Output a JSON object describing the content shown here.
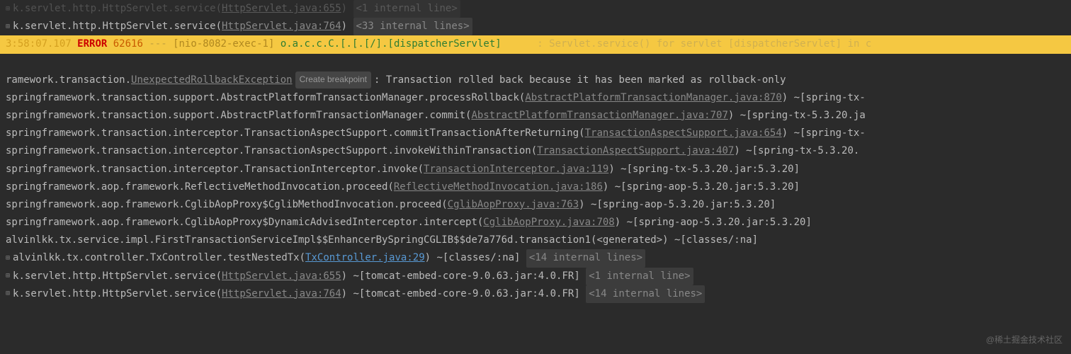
{
  "topline0": {
    "prefix": "k.servlet.http.HttpServlet.service(",
    "link": "HttpServlet.java:655",
    "suffix": ")",
    "internal": "<1 internal line>"
  },
  "topline1": {
    "prefix": "k.servlet.http.HttpServlet.service(",
    "link": "HttpServlet.java:764",
    "suffix": ")",
    "internal": "<33 internal lines>"
  },
  "log": {
    "ts": "3:58:07.107",
    "level": "ERROR",
    "pid": "62616",
    "sep": "---",
    "thread": "[nio-8082-exec-1]",
    "logger": "o.a.c.c.C.[.[.[/].[dispatcherServlet]",
    "colon": ":",
    "msg": "Servlet.service() for servlet [dispatcherServlet] in c"
  },
  "exception": {
    "prefix": "ramework.transaction.",
    "link": "UnexpectedRollbackException",
    "breakpoint": "Create breakpoint",
    "message": ": Transaction rolled back because it has been marked as rollback-only"
  },
  "stack": [
    {
      "prefix": "springframework.transaction.support.AbstractPlatformTransactionManager.processRollback(",
      "link": "AbstractPlatformTransactionManager.java:870",
      "suffix": ") ~[spring-tx-"
    },
    {
      "prefix": "springframework.transaction.support.AbstractPlatformTransactionManager.commit(",
      "link": "AbstractPlatformTransactionManager.java:707",
      "suffix": ") ~[spring-tx-5.3.20.ja"
    },
    {
      "prefix": "springframework.transaction.interceptor.TransactionAspectSupport.commitTransactionAfterReturning(",
      "link": "TransactionAspectSupport.java:654",
      "suffix": ") ~[spring-tx-"
    },
    {
      "prefix": "springframework.transaction.interceptor.TransactionAspectSupport.invokeWithinTransaction(",
      "link": "TransactionAspectSupport.java:407",
      "suffix": ") ~[spring-tx-5.3.20."
    },
    {
      "prefix": "springframework.transaction.interceptor.TransactionInterceptor.invoke(",
      "link": "TransactionInterceptor.java:119",
      "suffix": ") ~[spring-tx-5.3.20.jar:5.3.20]"
    },
    {
      "prefix": "springframework.aop.framework.ReflectiveMethodInvocation.proceed(",
      "link": "ReflectiveMethodInvocation.java:186",
      "suffix": ") ~[spring-aop-5.3.20.jar:5.3.20]"
    },
    {
      "prefix": "springframework.aop.framework.CglibAopProxy$CglibMethodInvocation.proceed(",
      "link": "CglibAopProxy.java:763",
      "suffix": ") ~[spring-aop-5.3.20.jar:5.3.20]"
    },
    {
      "prefix": "springframework.aop.framework.CglibAopProxy$DynamicAdvisedInterceptor.intercept(",
      "link": "CglibAopProxy.java:708",
      "suffix": ") ~[spring-aop-5.3.20.jar:5.3.20]"
    },
    {
      "prefix": "alvinlkk.tx.service.impl.FirstTransactionServiceImpl$$EnhancerBySpringCGLIB$$de7a776d.transaction1(<generated>) ~[classes/:na]",
      "link": "",
      "suffix": ""
    }
  ],
  "txcontroller": {
    "prefix": "alvinlkk.tx.controller.TxController.testNestedTx(",
    "link": "TxController.java:29",
    "suffix": ") ~[classes/:na]",
    "internal": "<14 internal lines>"
  },
  "bottom1": {
    "prefix": "k.servlet.http.HttpServlet.service(",
    "link": "HttpServlet.java:655",
    "suffix": ") ~[tomcat-embed-core-9.0.63.jar:4.0.FR]",
    "internal": "<1 internal line>"
  },
  "bottom2": {
    "prefix": "k.servlet.http.HttpServlet.service(",
    "link": "HttpServlet.java:764",
    "suffix": ") ~[tomcat-embed-core-9.0.63.jar:4.0.FR]",
    "internal": "<14 internal lines>"
  },
  "watermark": "@稀土掘金技术社区"
}
